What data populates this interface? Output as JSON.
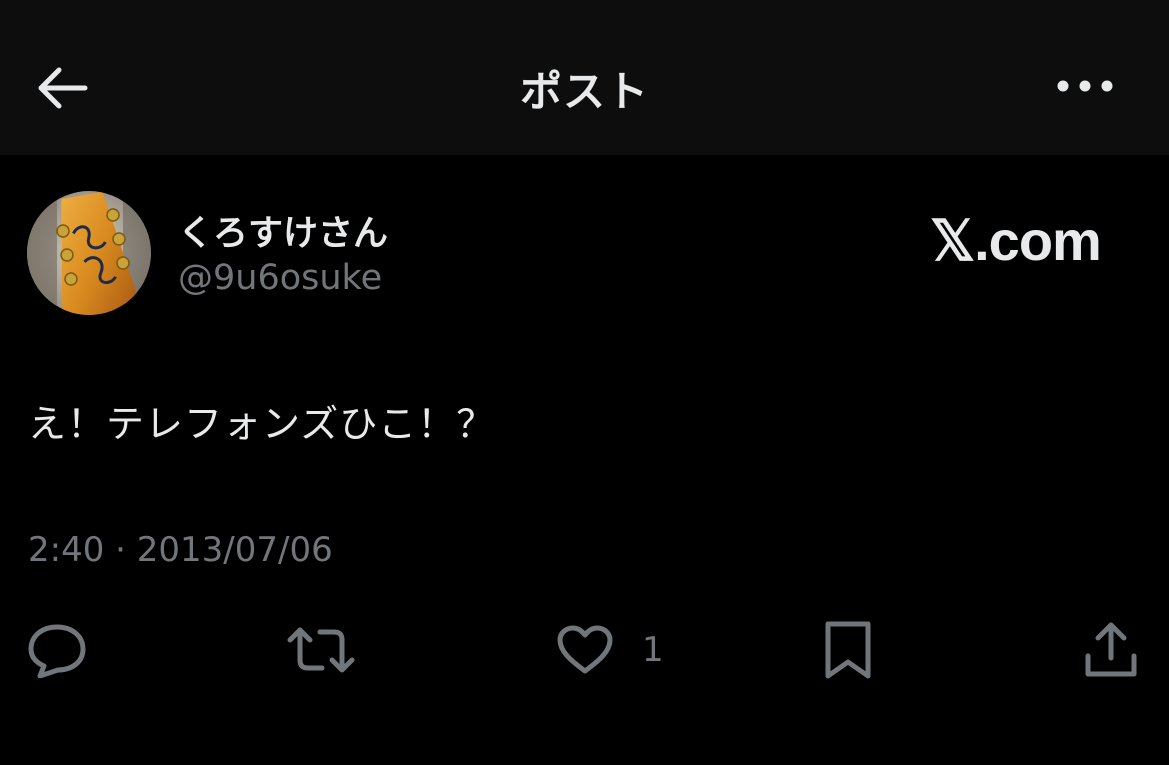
{
  "header": {
    "title": "ポスト",
    "back_icon": "arrow-left-icon",
    "more_icon": "more-horizontal-icon"
  },
  "post": {
    "author": {
      "display_name": "くろすけさん",
      "handle": "@9u6osuke",
      "avatar": "avatar-guitar-headstock-image"
    },
    "source_label": "𝕏.com",
    "text": "え！テレフォンズひこ！？",
    "timestamp": "2:40 · 2013/07/06",
    "actions": {
      "reply_icon": "reply-bubble-icon",
      "repost_icon": "repost-icon",
      "like_icon": "heart-icon",
      "like_count": "1",
      "bookmark_icon": "bookmark-icon",
      "share_icon": "share-upload-icon"
    }
  },
  "colors": {
    "background": "#000000",
    "header_background": "#0d0d0d",
    "primary_text": "#e7e9ea",
    "secondary_text": "#71767b"
  }
}
